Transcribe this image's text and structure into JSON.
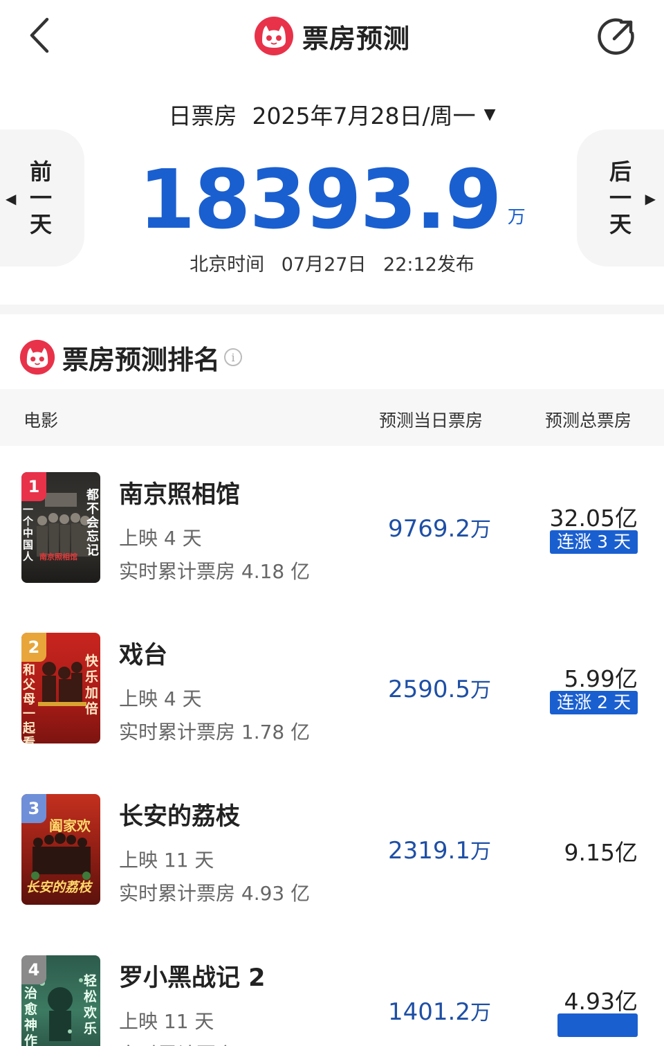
{
  "header": {
    "title": "票房预测",
    "back_icon": "chevron-left-icon",
    "share_icon": "share-icon"
  },
  "date_bar": {
    "label": "日票房",
    "value": "2025年7月28日/周一",
    "caret": "▼"
  },
  "nav": {
    "prev": [
      "前",
      "一",
      "天"
    ],
    "next": [
      "后",
      "一",
      "天"
    ],
    "prev_arrow": "◀",
    "next_arrow": "▶"
  },
  "summary": {
    "total": "18393.9",
    "unit": "万",
    "release_prefix": "北京时间",
    "release_date": "07月27日",
    "release_time": "22:12发布"
  },
  "ranking": {
    "title": "票房预测排名",
    "info_icon": "i",
    "columns": {
      "movie": "电影",
      "today": "预测当日票房",
      "total": "预测总票房"
    },
    "rows": [
      {
        "rank": "1",
        "title": "南京照相馆",
        "days": "上映 4 天",
        "cumulative": "实时累计票房 4.18 亿",
        "today_value": "9769.2",
        "today_unit": "万",
        "total": "32.05亿",
        "streak": "连涨 3 天",
        "badge_color": "#e8324a",
        "poster_text_left": "一个中国人",
        "poster_text_right": "都不会忘记",
        "poster_text_bottom": "南京照相馆"
      },
      {
        "rank": "2",
        "title": "戏台",
        "days": "上映 4 天",
        "cumulative": "实时累计票房 1.78 亿",
        "today_value": "2590.5",
        "today_unit": "万",
        "total": "5.99亿",
        "streak": "连涨 2 天",
        "badge_color": "#e8a53a",
        "poster_text_left": "和父母一起看",
        "poster_text_right": "快乐加倍"
      },
      {
        "rank": "3",
        "title": "长安的荔枝",
        "days": "上映 11 天",
        "cumulative": "实时累计票房 4.93 亿",
        "today_value": "2319.1",
        "today_unit": "万",
        "total": "9.15亿",
        "streak": "",
        "badge_color": "#6f8fd8",
        "poster_text_top": "阖家欢",
        "poster_text_bottom": "长安的荔枝"
      },
      {
        "rank": "4",
        "title": "罗小黑战记 2",
        "days": "上映 11 天",
        "cumulative": "实时累计票房",
        "today_value": "1401.2",
        "today_unit": "万",
        "total": "4.93亿",
        "streak": "",
        "badge_color": "#8a8a8a",
        "poster_text_left": "治愈神作",
        "poster_text_right": "轻松欢乐"
      }
    ]
  },
  "colors": {
    "accent_blue": "#1a5fd0",
    "today_blue": "#1e4fa5",
    "brand_red": "#e8324a"
  }
}
